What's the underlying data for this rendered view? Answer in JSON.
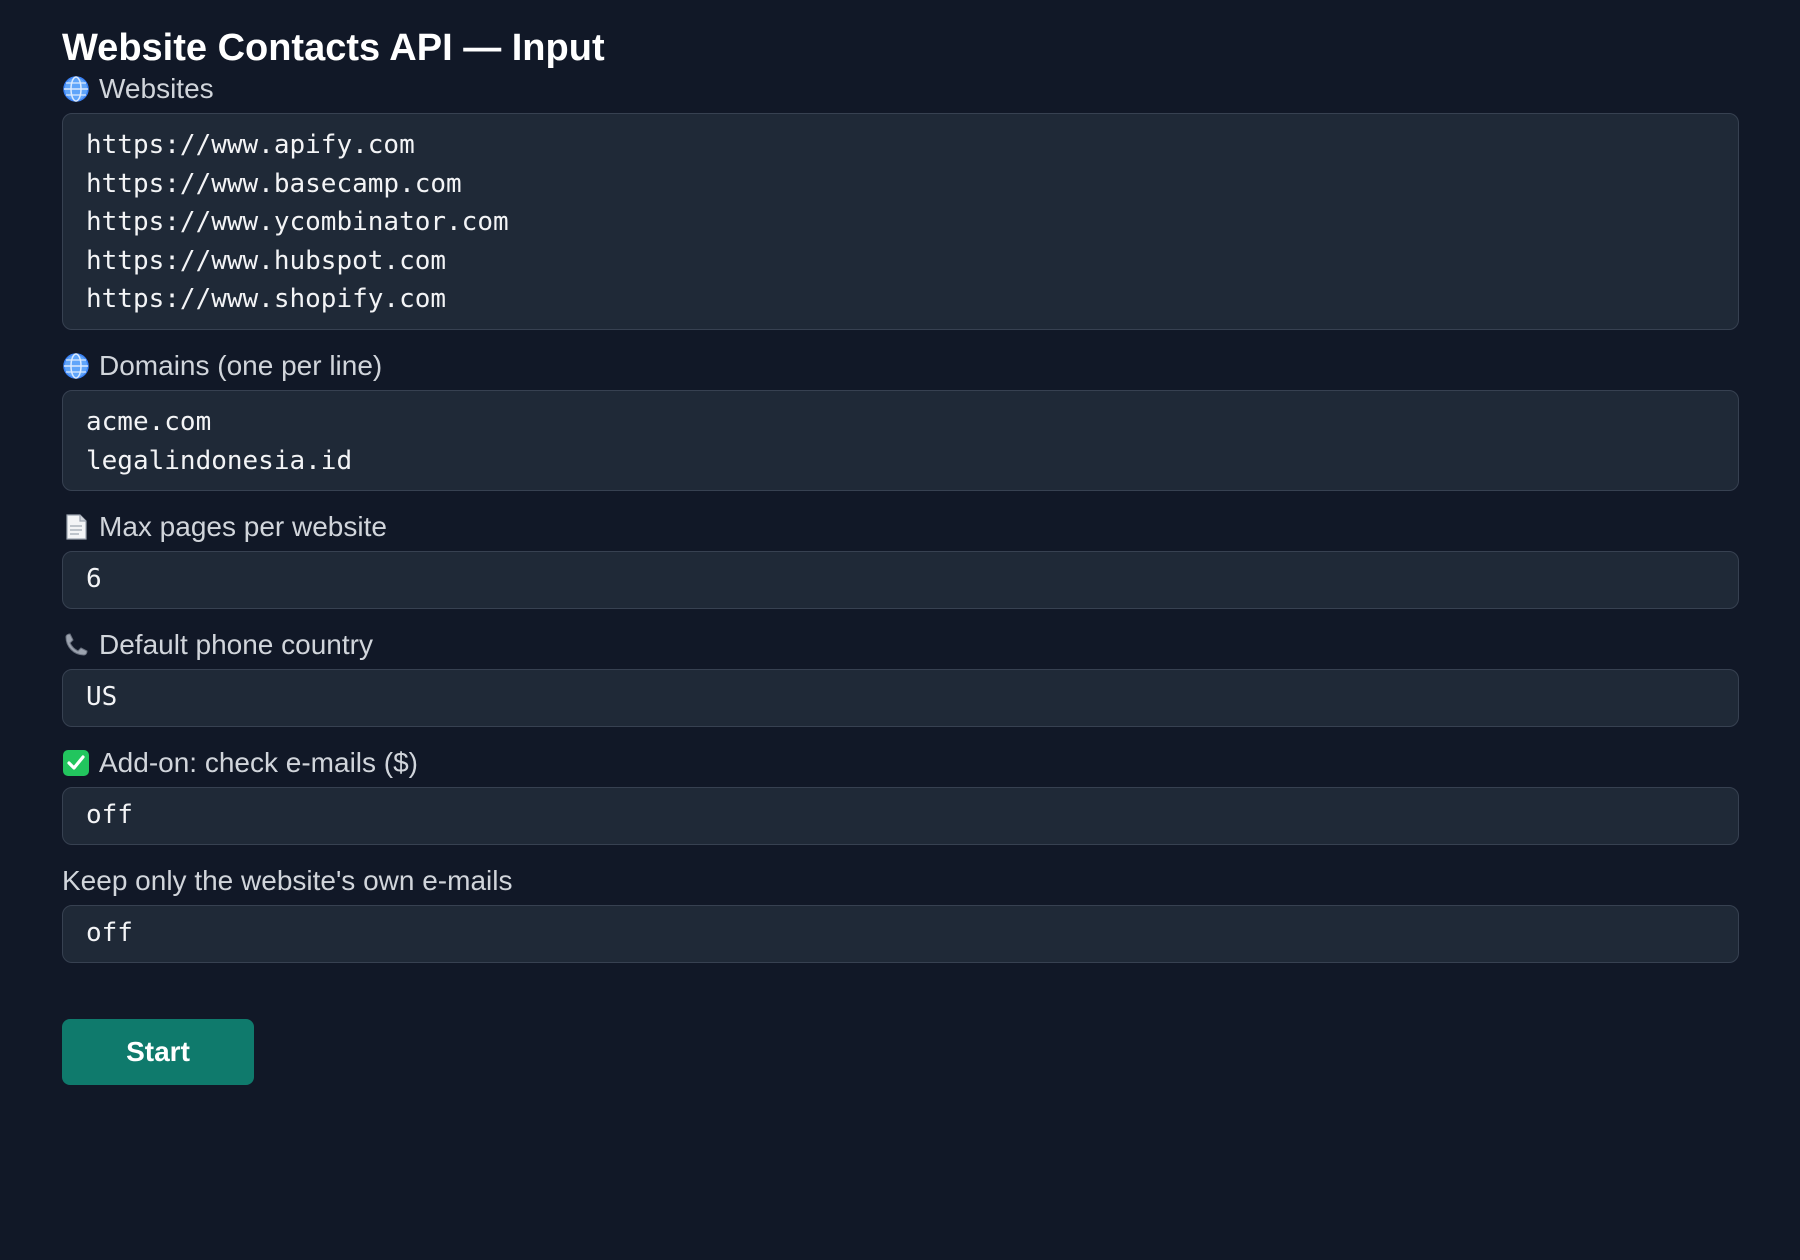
{
  "page": {
    "title": "Website Contacts API — Input"
  },
  "fields": {
    "websites": {
      "icon": "globe-icon",
      "label": "Websites",
      "lines": [
        "https://www.apify.com",
        "https://www.basecamp.com",
        "https://www.ycombinator.com",
        "https://www.hubspot.com",
        "https://www.shopify.com"
      ]
    },
    "domains": {
      "icon": "globe-icon",
      "label": "Domains (one per line)",
      "lines": [
        "acme.com",
        "legalindonesia.id"
      ]
    },
    "max_pages": {
      "icon": "page-icon",
      "label": "Max pages per website",
      "value": "6"
    },
    "phone_country": {
      "icon": "phone-icon",
      "label": "Default phone country",
      "value": "US"
    },
    "check_emails": {
      "icon": "checkmark-icon",
      "label": "Add-on: check e-mails ($)",
      "value": "off"
    },
    "own_emails": {
      "label": "Keep only the website's own e-mails",
      "value": "off"
    }
  },
  "actions": {
    "start_label": "Start"
  },
  "colors": {
    "background": "#111827",
    "field_background": "#1f2937",
    "field_border": "#374151",
    "accent": "#0f7a6c"
  }
}
